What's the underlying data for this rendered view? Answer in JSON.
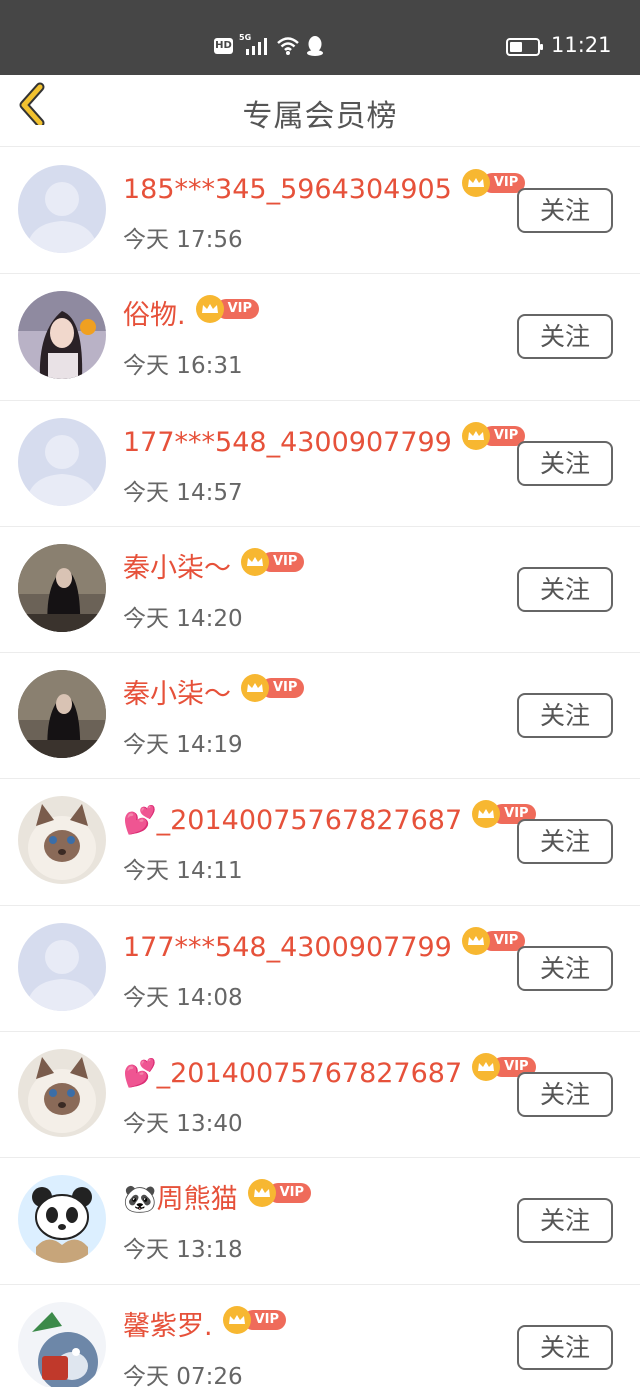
{
  "status_bar": {
    "hd": "HD",
    "network": "5G",
    "time": "11:21"
  },
  "header": {
    "title": "专属会员榜"
  },
  "vip_label": "VIP",
  "follow_label": "关注",
  "items": [
    {
      "name": "185***345_5964304905",
      "time": "今天 17:56",
      "avatar": "placeholder"
    },
    {
      "name": "俗物.",
      "time": "今天 16:31",
      "avatar": "girl-photo"
    },
    {
      "name": "177***548_4300907799",
      "time": "今天 14:57",
      "avatar": "placeholder"
    },
    {
      "name": "秦小柒～",
      "time": "今天 14:20",
      "avatar": "dark-photo"
    },
    {
      "name": "秦小柒～",
      "time": "今天 14:19",
      "avatar": "dark-photo"
    },
    {
      "name": "💕_20140075767827687",
      "time": "今天 14:11",
      "avatar": "cat-photo"
    },
    {
      "name": "177***548_4300907799",
      "time": "今天 14:08",
      "avatar": "placeholder"
    },
    {
      "name": "💕_20140075767827687",
      "time": "今天 13:40",
      "avatar": "cat-photo"
    },
    {
      "name": "🐼周熊猫",
      "time": "今天 13:18",
      "avatar": "panda-cartoon"
    },
    {
      "name": "馨紫罗.",
      "time": "今天 07:26",
      "avatar": "cartoon-cat"
    }
  ],
  "colors": {
    "status_bar": "#464646",
    "name_red": "#e6513a",
    "vip_tag": "#ef6b5a",
    "vip_crown": "#f7b731",
    "back_arrow": "#f2c230"
  }
}
